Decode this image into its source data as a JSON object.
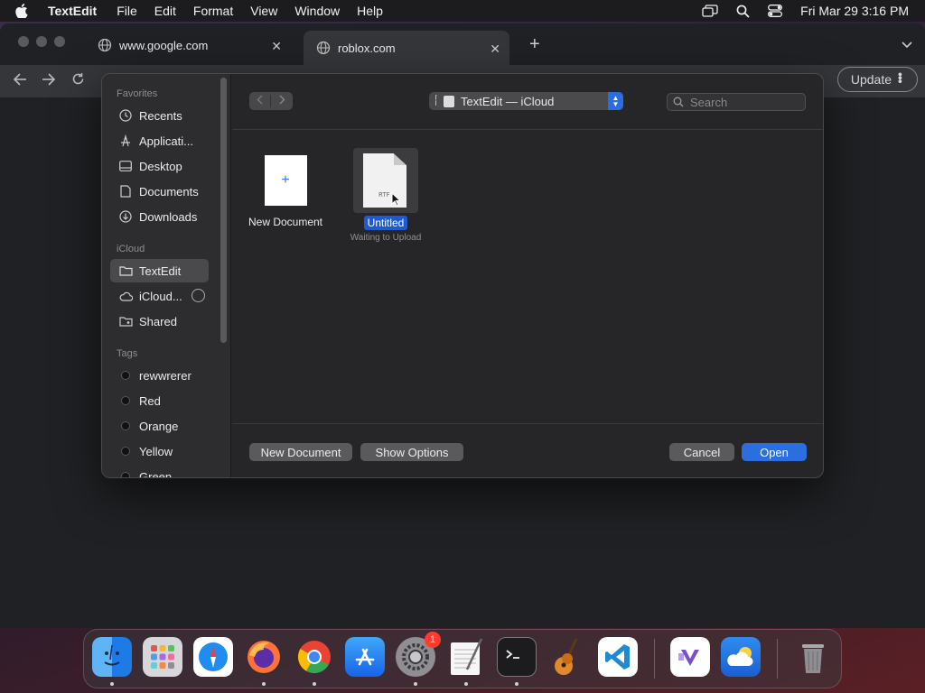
{
  "menubar": {
    "app_name": "TextEdit",
    "items": [
      "File",
      "Edit",
      "Format",
      "View",
      "Window",
      "Help"
    ],
    "datetime": "Fri Mar 29  3:16 PM"
  },
  "browser": {
    "tabs": [
      {
        "title": "www.google.com",
        "close": "✕"
      },
      {
        "title": "roblox.com",
        "close": "✕"
      }
    ],
    "new_tab": "+",
    "update_label": "Update"
  },
  "dialog": {
    "sidebar": {
      "favorites_heading": "Favorites",
      "favorites": [
        "Recents",
        "Applicati...",
        "Desktop",
        "Documents",
        "Downloads"
      ],
      "icloud_heading": "iCloud",
      "icloud": [
        "TextEdit",
        "iCloud...",
        "Shared"
      ],
      "tags_heading": "Tags",
      "tags": [
        "rewwrerer",
        "Red",
        "Orange",
        "Yellow",
        "Green"
      ]
    },
    "location": "TextEdit — iCloud",
    "search_placeholder": "Search",
    "files": {
      "new_doc_label": "New Document",
      "new_doc_plus": "+",
      "untitled_label": "Untitled",
      "untitled_type": "RTF",
      "untitled_status": "Waiting to Upload"
    },
    "buttons": {
      "new_document": "New Document",
      "show_options": "Show Options",
      "cancel": "Cancel",
      "open": "Open"
    }
  },
  "dock": {
    "apps": [
      "finder",
      "launchpad",
      "safari",
      "firefox",
      "chrome",
      "app-store",
      "system-settings",
      "textedit",
      "terminal",
      "garageband",
      "vscode",
      "visual-studio",
      "weather",
      "trash"
    ],
    "settings_badge": "1"
  },
  "colors": {
    "accent": "#2a6ee0",
    "selection": "#1e5bd1",
    "badge": "#ff3b30"
  }
}
